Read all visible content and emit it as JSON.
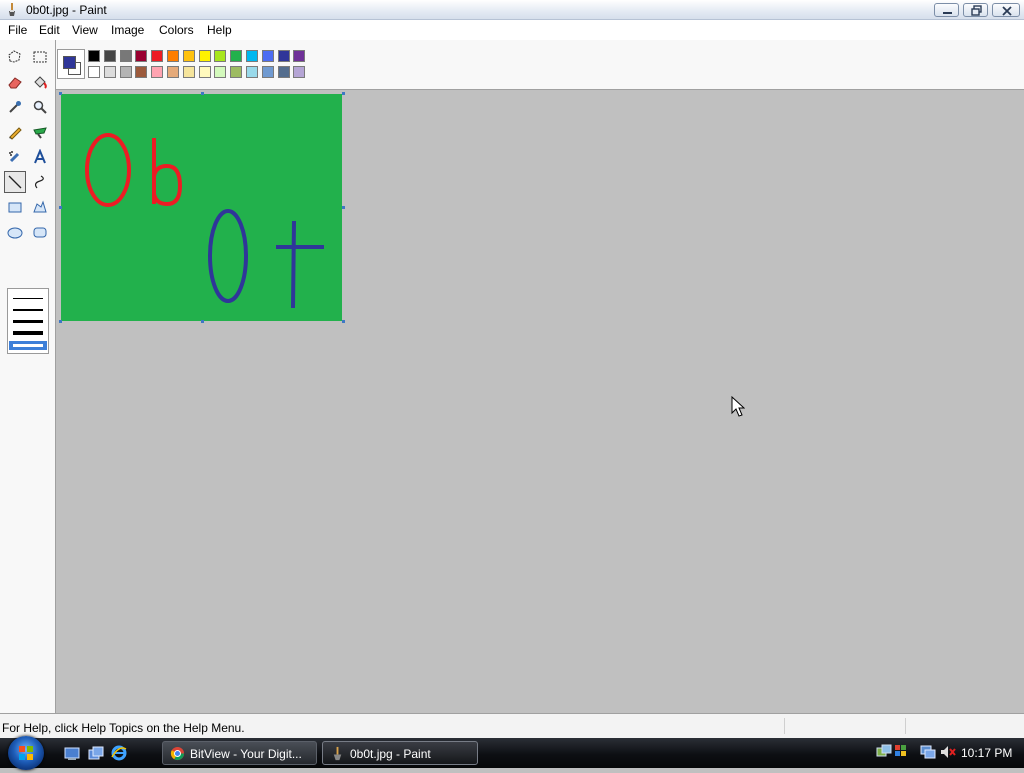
{
  "window": {
    "title": "0b0t.jpg - Paint"
  },
  "menu": [
    "File",
    "Edit",
    "View",
    "Image",
    "Colors",
    "Help"
  ],
  "tools": [
    "free-form-select",
    "select",
    "eraser",
    "fill-with-color",
    "pick-color",
    "magnifier",
    "pencil",
    "brush",
    "airbrush",
    "text",
    "line",
    "curve",
    "rectangle",
    "polygon",
    "ellipse",
    "rounded-rectangle"
  ],
  "selected_tool": "line",
  "palette": {
    "foreground": "#2f3699",
    "background": "#ffffff",
    "top_row": [
      "#000000",
      "#464646",
      "#787878",
      "#990030",
      "#ed1c24",
      "#ff7e00",
      "#ffc20e",
      "#fff200",
      "#a8e61d",
      "#22b14c",
      "#00b7ef",
      "#4d6df3",
      "#2f3699",
      "#6f3198"
    ],
    "bottom_row": [
      "#ffffff",
      "#dcdcdc",
      "#b4b4b4",
      "#9c5a3c",
      "#ffa3b1",
      "#e5aa7a",
      "#f5e49c",
      "#fff9bd",
      "#d3f9bc",
      "#9dbb61",
      "#99d9ea",
      "#709ad1",
      "#546d8e",
      "#b5a5d5"
    ]
  },
  "canvas": {
    "background": "#22b14c",
    "drawing_colors": {
      "red": "#ed1c24",
      "blue": "#2f3699"
    }
  },
  "status": {
    "help_text": "For Help, click Help Topics on the Help Menu."
  },
  "taskbar": {
    "tasks": [
      {
        "label": "BitView - Your Digit...",
        "icon": "chrome-icon"
      },
      {
        "label": "0b0t.jpg - Paint",
        "icon": "paint-icon",
        "active": true
      }
    ],
    "clock": "10:17 PM"
  }
}
